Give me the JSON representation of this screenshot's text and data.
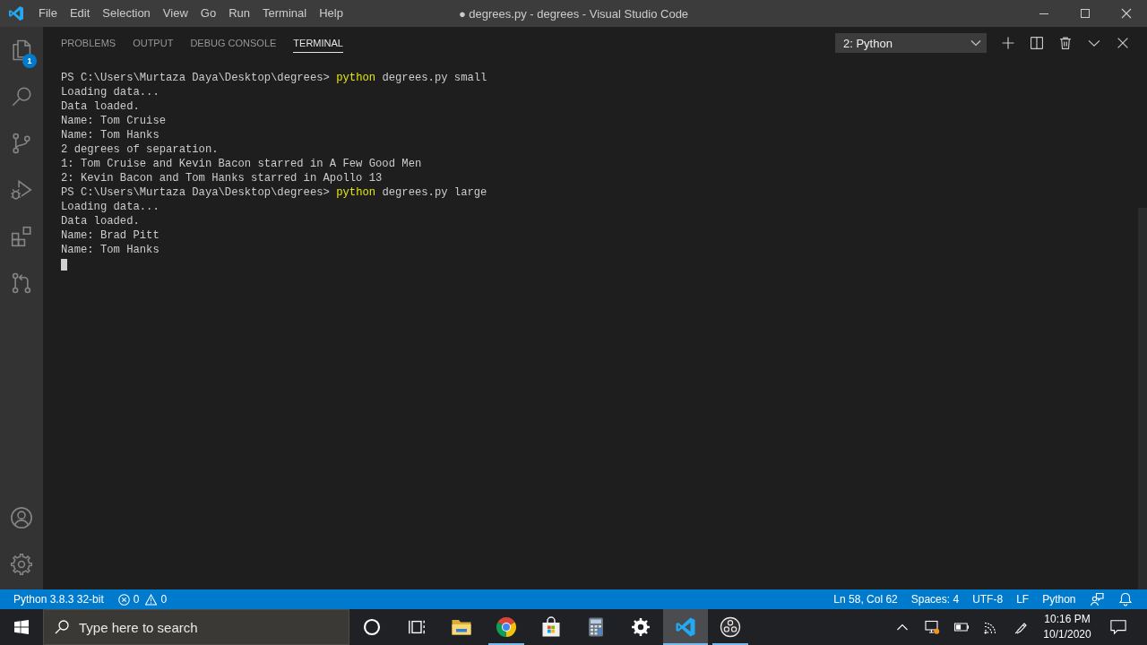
{
  "title_bar": {
    "menu": [
      "File",
      "Edit",
      "Selection",
      "View",
      "Go",
      "Run",
      "Terminal",
      "Help"
    ],
    "title": "● degrees.py - degrees - Visual Studio Code"
  },
  "activity_bar": {
    "top": [
      {
        "kind": "explorer",
        "badge": "1"
      },
      {
        "kind": "search"
      },
      {
        "kind": "source_control"
      },
      {
        "kind": "run"
      },
      {
        "kind": "extensions"
      },
      {
        "kind": "pull_requests"
      }
    ],
    "bottom": [
      {
        "kind": "accounts"
      },
      {
        "kind": "manage"
      }
    ]
  },
  "panel": {
    "tabs": [
      {
        "label": "PROBLEMS",
        "selected": false
      },
      {
        "label": "OUTPUT",
        "selected": false
      },
      {
        "label": "DEBUG CONSOLE",
        "selected": false
      },
      {
        "label": "TERMINAL",
        "selected": true
      }
    ],
    "terminal_picker": "2: Python",
    "terminal": {
      "lines": [
        {
          "kind": "command",
          "prompt": "PS C:\\Users\\Murtaza Daya\\Desktop\\degrees>",
          "command": "python",
          "args": "degrees.py small"
        },
        {
          "kind": "output",
          "text": "Loading data..."
        },
        {
          "kind": "output",
          "text": "Data loaded."
        },
        {
          "kind": "output",
          "text": "Name: Tom Cruise"
        },
        {
          "kind": "output",
          "text": "Name: Tom Hanks"
        },
        {
          "kind": "output",
          "text": "2 degrees of separation."
        },
        {
          "kind": "output",
          "text": "1: Tom Cruise and Kevin Bacon starred in A Few Good Men"
        },
        {
          "kind": "output",
          "text": "2: Kevin Bacon and Tom Hanks starred in Apollo 13"
        },
        {
          "kind": "command",
          "prompt": "PS C:\\Users\\Murtaza Daya\\Desktop\\degrees>",
          "command": "python",
          "args": "degrees.py large"
        },
        {
          "kind": "output",
          "text": "Loading data..."
        },
        {
          "kind": "output",
          "text": "Data loaded."
        },
        {
          "kind": "output",
          "text": "Name: Brad Pitt"
        },
        {
          "kind": "output",
          "text": "Name: Tom Hanks"
        }
      ],
      "cursor": true
    }
  },
  "status_bar": {
    "left": [
      {
        "kind": "text",
        "text": "Python 3.8.3 32-bit"
      },
      {
        "kind": "problems",
        "errors": "0",
        "warnings": "0"
      }
    ],
    "right": [
      "Ln 58, Col 62",
      "Spaces: 4",
      "UTF-8",
      "LF",
      "Python"
    ]
  },
  "taskbar": {
    "search": {
      "placeholder": "Type here to search"
    },
    "apps": [
      {
        "kind": "file_explorer",
        "running": false,
        "active": false
      },
      {
        "kind": "chrome",
        "running": true,
        "active": false
      },
      {
        "kind": "store",
        "running": false,
        "active": false
      },
      {
        "kind": "calculator",
        "running": false,
        "active": false
      },
      {
        "kind": "settings",
        "running": false,
        "active": false
      },
      {
        "kind": "vscode",
        "running": true,
        "active": true
      },
      {
        "kind": "obs",
        "running": true,
        "active": false
      }
    ],
    "clock": {
      "time": "10:16 PM",
      "date": "10/1/2020"
    }
  }
}
